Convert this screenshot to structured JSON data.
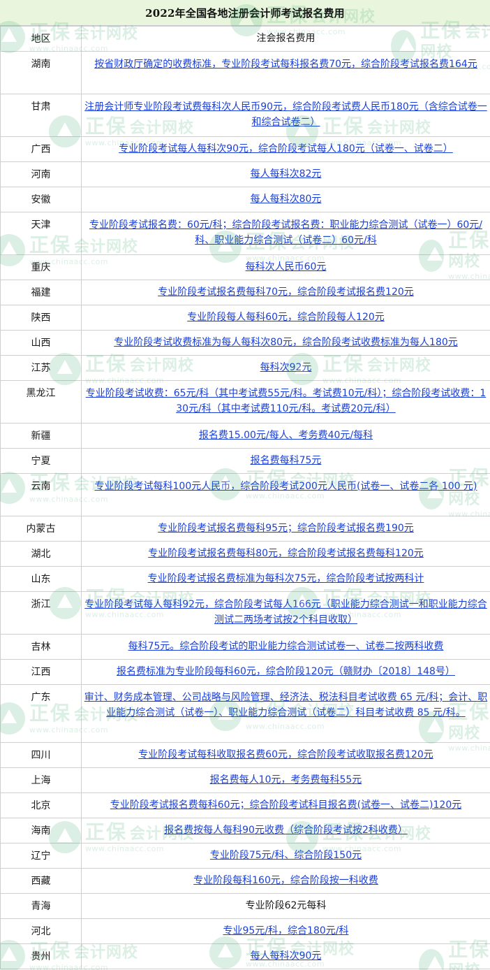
{
  "title": "2022年全国各地注册会计师考试报名费用",
  "header": {
    "region": "地区",
    "fee": "注会报名费用"
  },
  "rows": [
    {
      "region": "湖南",
      "fee": "按省财政厅确定的收费标准，专业阶段考试每科报名费70元，综合阶段考试报名费164元"
    },
    {
      "region": "甘肃",
      "fee": "注册会计师专业阶段考试费每科次人民币90元，综合阶段考试费人民币180元（含综合试卷一和综合试卷二）"
    },
    {
      "region": "广西",
      "fee": "专业阶段考试每人每科次90元，综合阶段考试每人180元（试卷一、试卷二）"
    },
    {
      "region": "河南",
      "fee": "每人每科次82元"
    },
    {
      "region": "安徽",
      "fee": "每人每科次80元"
    },
    {
      "region": "天津",
      "fee": "专业阶段考试报名费：60元/科；综合阶段考试报名费：职业能力综合测试（试卷一）60元/科、职业能力综合测试（试卷二）60元/科"
    },
    {
      "region": "重庆",
      "fee": "每科次人民币60元"
    },
    {
      "region": "福建",
      "fee": "专业阶段考试报名费每科70元，综合阶段考试报名费120元"
    },
    {
      "region": "陕西",
      "fee": "专业阶段每人每科60元，综合阶段每人120元"
    },
    {
      "region": "山西",
      "fee": "专业阶段考试收费标准为每人每科次80元，综合阶段考试收费标准为每人180元"
    },
    {
      "region": "江苏",
      "fee": "每科次92元"
    },
    {
      "region": "黑龙江",
      "fee": "专业阶段考试收费：65元/科（其中考试费55元/科。考试费10元/科）；综合阶段考试收费：130元/科（其中考试费110元/科。考试费20元/科）"
    },
    {
      "region": "新疆",
      "fee": "报名费15.00元/每人、考务费40元/每科"
    },
    {
      "region": "宁夏",
      "fee": "报名费每科75元"
    },
    {
      "region": "云南",
      "fee": "专业阶段考试每科100元人民币，综合阶段考试200元人民币(试卷一、试卷二各 100 元)"
    },
    {
      "region": "内蒙古",
      "fee": "专业阶段考试报名费每科95元；综合阶段考试报名费190元"
    },
    {
      "region": "湖北",
      "fee": "专业阶段考试报名费每科80元，综合阶段考试报名费每科120元"
    },
    {
      "region": "山东",
      "fee": "专业阶段考试报名费标准为每科次75元，综合阶段考试按两科计"
    },
    {
      "region": "浙江",
      "fee": "专业阶段考试每人每科92元，综合阶段考试每人166元（职业能力综合测试一和职业能力综合测试二两场考试按2个科目收取）"
    },
    {
      "region": "吉林",
      "fee": "每科75元。综合阶段考试的职业能力综合测试试卷一、试卷二按两科收费"
    },
    {
      "region": "江西",
      "fee": "报名费标准为专业阶段每科60元，综合阶段120元（赣财办〔2018〕148号）"
    },
    {
      "region": "广东",
      "fee": "审计、财务成本管理、公司战略与风险管理、经济法、税法科目考试收费 65 元/科；会计、职业能力综合测试（试卷一）、职业能力综合测试（试卷二）科目考试收费 85 元/科。"
    },
    {
      "region": "四川",
      "fee": "专业阶段考试每科收取报名费60元，综合阶段考试收取报名费120元"
    },
    {
      "region": "上海",
      "fee": "报名费每人10元，考务费每科55元"
    },
    {
      "region": "北京",
      "fee": "专业阶段考试报名费每科60元；综合阶段考试科目报名费(试卷一、试卷二)120元"
    },
    {
      "region": "海南",
      "fee": "报名费按每人每科90元收费（综合阶段考试按2科收费）"
    },
    {
      "region": "辽宁",
      "fee": "专业阶段75元/科、综合阶段150元"
    },
    {
      "region": "西藏",
      "fee": "专业阶段每科160元，综合阶段按一科收费"
    },
    {
      "region": "青海",
      "fee": "专业阶段62元每科"
    },
    {
      "region": "河北",
      "fee": "专业95元/科，综合180元/科"
    },
    {
      "region": "贵州",
      "fee": "每人每科次90元"
    }
  ],
  "watermark": {
    "brand": "正保",
    "suffix": "会计网校",
    "url": "www.chinaacc.com",
    "color": "#27a15c"
  }
}
